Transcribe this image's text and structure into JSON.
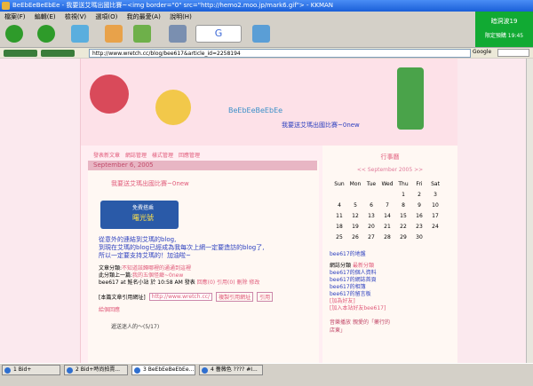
{
  "window": {
    "title": "BeEbEeBeEbEe - 我要送艾瑪出國比賽~<img border=\"0\" src=\"http://hemo2.moo.jp/mark6.gif\"> - KKMAN"
  },
  "menu": [
    "檔案(F)",
    "編輯(E)",
    "檢視(V)",
    "選項(O)",
    "我的最愛(A)",
    "說明(H)"
  ],
  "address": {
    "url": "http://www.wretch.cc/blog/bee617&article_id=2258194",
    "search_engine": "Google"
  },
  "ad": {
    "line1": "暗洞波19",
    "line2": "限定預購 19:45"
  },
  "blog": {
    "title": "BeEbEeBeEbEe",
    "subtitle": "我要送艾瑪出國比賽~0new",
    "tabs": [
      "發表新文章",
      "網誌管理",
      "樣式管理",
      "回應管理"
    ],
    "date": "September 6, 2005",
    "post_title": "我要送艾瑪出國比賽~0new",
    "banner_line1": "免費搭乘",
    "banner_line2": "曙光號",
    "body_lines": [
      "從意外的連結到艾瑪的blog,",
      "到現在艾瑪的blog已經成為我每次上網一定要造訪的blog了,",
      "所以一定要支持艾瑪的！加油啦~"
    ],
    "category_label": "文章分類:",
    "category_value": "不知道該歸哪裡的通通到這裡",
    "prev_label": "此分類上一篇:",
    "prev_value": "我的五個怪癖~0new",
    "footer_meta": "bee617 at 鮭名小站 於 10:58 AM 發表",
    "footer_links": [
      "回應(0)",
      "引用(0)",
      "刪除",
      "修改"
    ],
    "trackback_label": "[本篇文章引用網址]",
    "trackback_url": "http://www.wretch.cc/",
    "trackback_copy": "複製引用網址",
    "trackback_btn": "引用",
    "small_link": "給個回應",
    "next_item": "遞送迷人的～(5/17)"
  },
  "calendar": {
    "title": "行事曆",
    "month_nav": "<< September 2005 >>",
    "days": [
      "Sun",
      "Mon",
      "Tue",
      "Wed",
      "Thu",
      "Fri",
      "Sat"
    ],
    "rows": [
      [
        "",
        "",
        "",
        "",
        "1",
        "2",
        "3"
      ],
      [
        "4",
        "5",
        "6",
        "7",
        "8",
        "9",
        "10"
      ],
      [
        "11",
        "12",
        "13",
        "14",
        "15",
        "16",
        "17"
      ],
      [
        "18",
        "19",
        "20",
        "21",
        "22",
        "23",
        "24"
      ],
      [
        "25",
        "26",
        "27",
        "28",
        "29",
        "30",
        ""
      ]
    ]
  },
  "sidebar": {
    "section1": "bee617的地盤",
    "links": [
      {
        "label": "網誌分類",
        "value": "最新分類"
      },
      {
        "label": "bee617的個人資料"
      },
      {
        "label": "bee617的網誌首頁"
      },
      {
        "label": "bee617的相簿"
      },
      {
        "label": "bee617的留言板"
      },
      {
        "label": "[加為好友]"
      },
      {
        "label": "[加入本站好友bee617]"
      }
    ],
    "section2_a": "音樂播放",
    "section2_b": "親愛的「藥行的",
    "section2_c": "店東」"
  },
  "taskbar": [
    "1 Bid+",
    "2 Bid+時尚拍賣...",
    "3 BeEbEeBeEbEe...",
    "4 薔薇色 ???? #I..."
  ]
}
